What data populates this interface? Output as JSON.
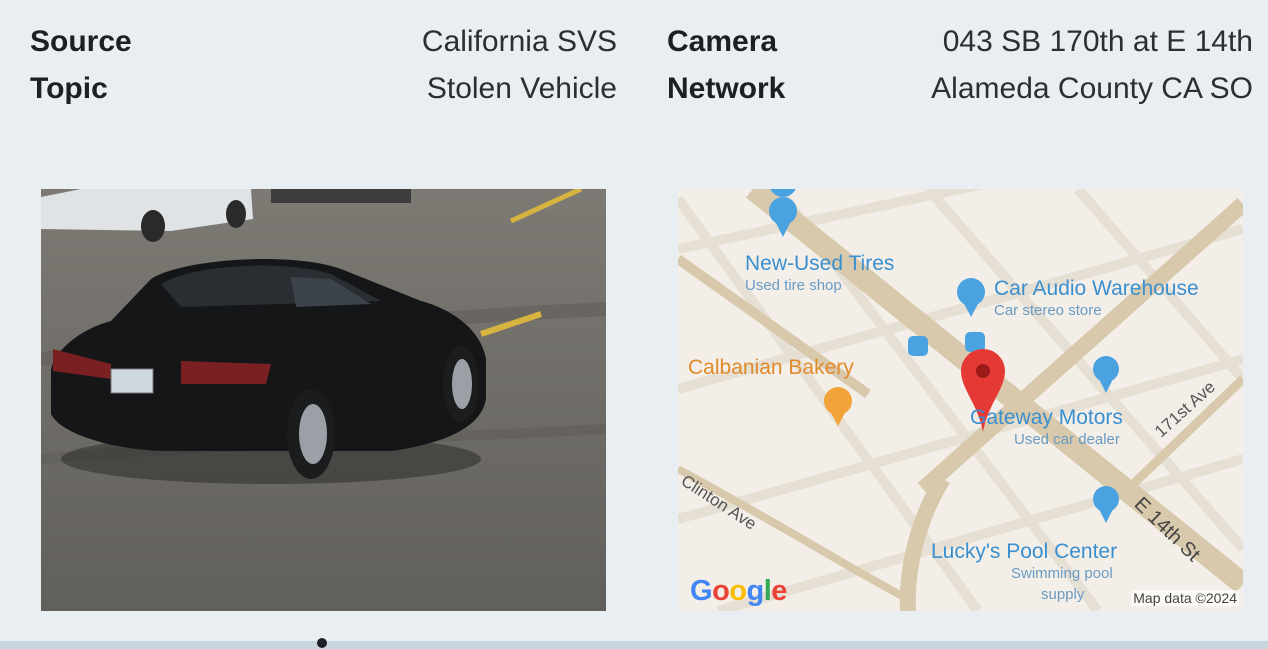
{
  "details": {
    "source_label": "Source",
    "source_value": "California SVS",
    "topic_label": "Topic",
    "topic_value": "Stolen Vehicle",
    "camera_label": "Camera",
    "camera_value": "043 SB 170th at E 14th",
    "network_label": "Network",
    "network_value": "Alameda County CA SO"
  },
  "map": {
    "places": [
      {
        "name": "New-Used Tires",
        "category": "Used tire shop"
      },
      {
        "name": "Car Audio Warehouse",
        "category": "Car stereo store"
      },
      {
        "name": "Calbanian Bakery",
        "category": ""
      },
      {
        "name": "Gateway Motors",
        "category": "Used car dealer"
      },
      {
        "name": "Lucky's Pool Center",
        "category": "Swimming pool supply"
      }
    ],
    "swimming_pool": "Swimming pool",
    "supply": "supply",
    "streets": [
      "171st Ave",
      "E 14th St",
      "Clinton Ave"
    ],
    "attribution": "Map data ©2024",
    "logo": "Google",
    "pin_color": "#e53935",
    "poi_color": "#4aa3e0",
    "food_color": "#f2a33a"
  },
  "photo": {
    "subject": "black sedan"
  }
}
